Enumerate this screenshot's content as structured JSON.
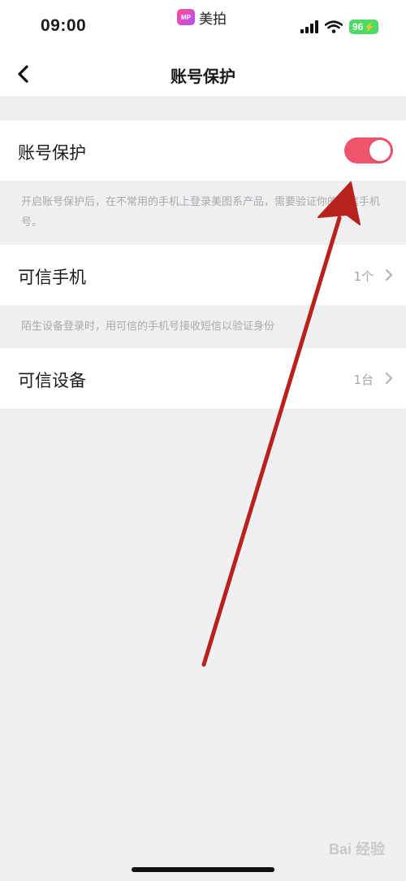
{
  "status_bar": {
    "time": "09:00",
    "app_logo_text": "MP",
    "app_name": "美拍",
    "battery": "96"
  },
  "nav": {
    "title": "账号保护",
    "back_icon": "chevron-left-icon"
  },
  "account_protection": {
    "label": "账号保护",
    "enabled": true,
    "toggle_color": "#f0536c",
    "hint": "开启账号保护后，在不常用的手机上登录美图系产品，需要验证你的可信手机号。"
  },
  "trusted_phone": {
    "label": "可信手机",
    "value": "1个",
    "hint": "陌生设备登录时，用可信的手机号接收短信以验证身份"
  },
  "trusted_device": {
    "label": "可信设备",
    "value": "1台"
  },
  "watermark": "Bai 经验"
}
